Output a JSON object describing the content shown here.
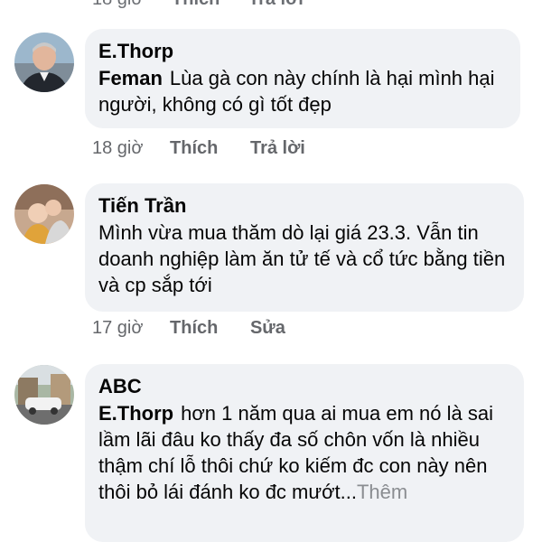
{
  "top_actions": {
    "time": "18 giờ",
    "like": "Thích",
    "reply": "Trả lời"
  },
  "comments": [
    {
      "author": "E.Thorp",
      "mention": "Feman",
      "text": "Lùa gà con này chính là hại mình hại người, không có gì tốt đẹp",
      "time": "18 giờ",
      "like": "Thích",
      "action2": "Trả lời",
      "avatar_icon": "man-portrait-avatar"
    },
    {
      "author": "Tiến Trần",
      "text": "Mình vừa mua thăm dò lại giá 23.3. Vẫn tin doanh nghiệp làm ăn tử tế và cổ tức bằng tiền và cp sắp tới",
      "time": "17 giờ",
      "like": "Thích",
      "action2": "Sửa",
      "avatar_icon": "baby-photo-avatar"
    },
    {
      "author": "ABC",
      "mention": "E.Thorp",
      "text": "hơn 1 năm qua ai mua em nó là sai lầm lãi đâu ko thấy đa số chôn vốn là nhiều thậm chí lỗ thôi chứ ko kiếm đc con này nên thôi bỏ lái đánh ko đc mướt...",
      "more": "Thêm",
      "avatar_icon": "street-car-avatar"
    }
  ],
  "colors": {
    "bubble_bg": "#f0f2f5",
    "text": "#050505",
    "meta": "#65676b"
  }
}
